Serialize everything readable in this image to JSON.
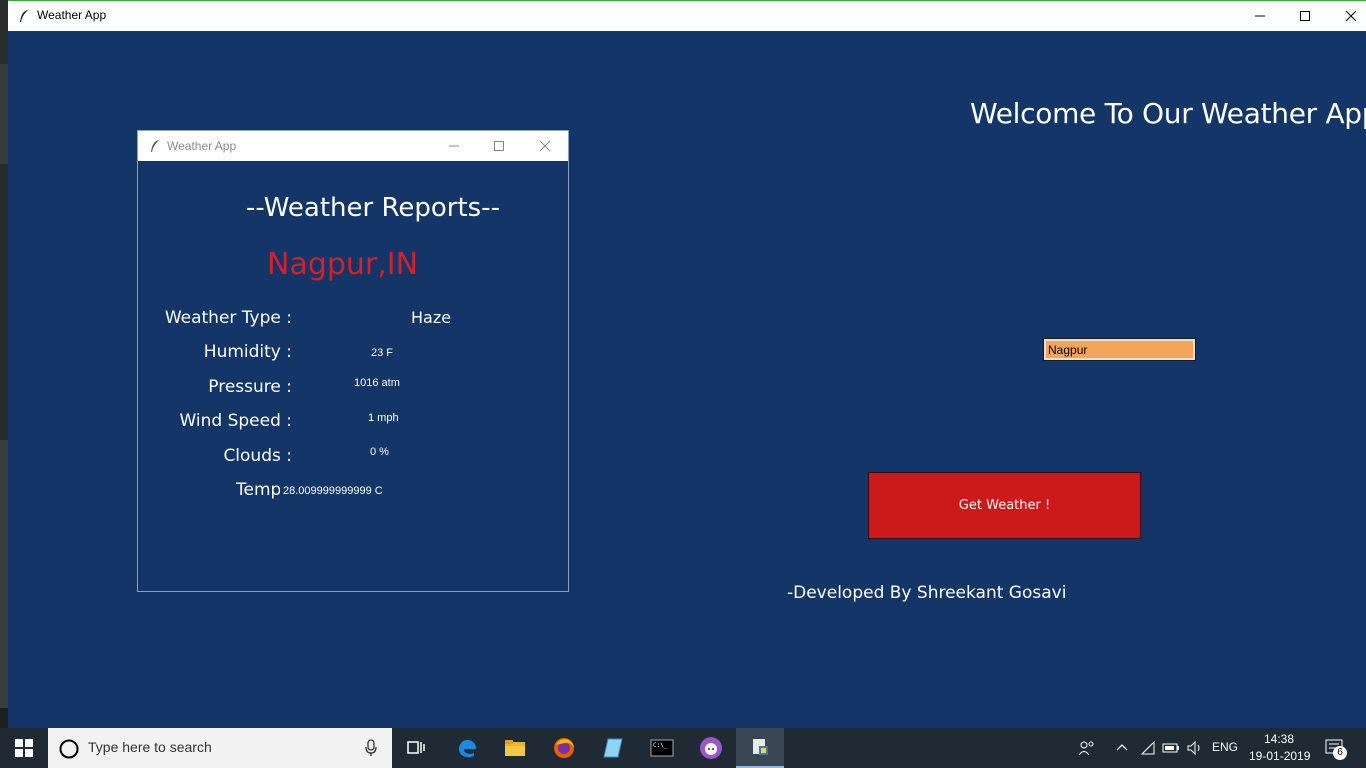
{
  "main_window": {
    "title": "Weather App",
    "welcome_text": "Welcome To Our Weather App",
    "city_input_value": "Nagpur",
    "get_weather_label": "Get Weather !",
    "developer_text": "-Developed By Shreekant Gosavi"
  },
  "report_window": {
    "title": "Weather App",
    "heading": "--Weather Reports--",
    "city": "Nagpur,IN",
    "rows": [
      {
        "label": "Weather Type :",
        "value": "Haze"
      },
      {
        "label": "Humidity :",
        "value": "23 F"
      },
      {
        "label": "Pressure :",
        "value": "1016 atm"
      },
      {
        "label": "Wind Speed :",
        "value": "1 mph"
      },
      {
        "label": "Clouds :",
        "value": "0 %"
      },
      {
        "label": "Temp",
        "value": "28.009999999999 C"
      }
    ]
  },
  "taskbar": {
    "search_placeholder": "Type here to search",
    "language": "ENG",
    "time": "14:38",
    "date": "19-01-2019",
    "notification_count": "6"
  },
  "colors": {
    "background": "#133567",
    "city_red": "#d4202a",
    "button_red": "#cc1a1a",
    "input_orange": "#f5a55a"
  }
}
